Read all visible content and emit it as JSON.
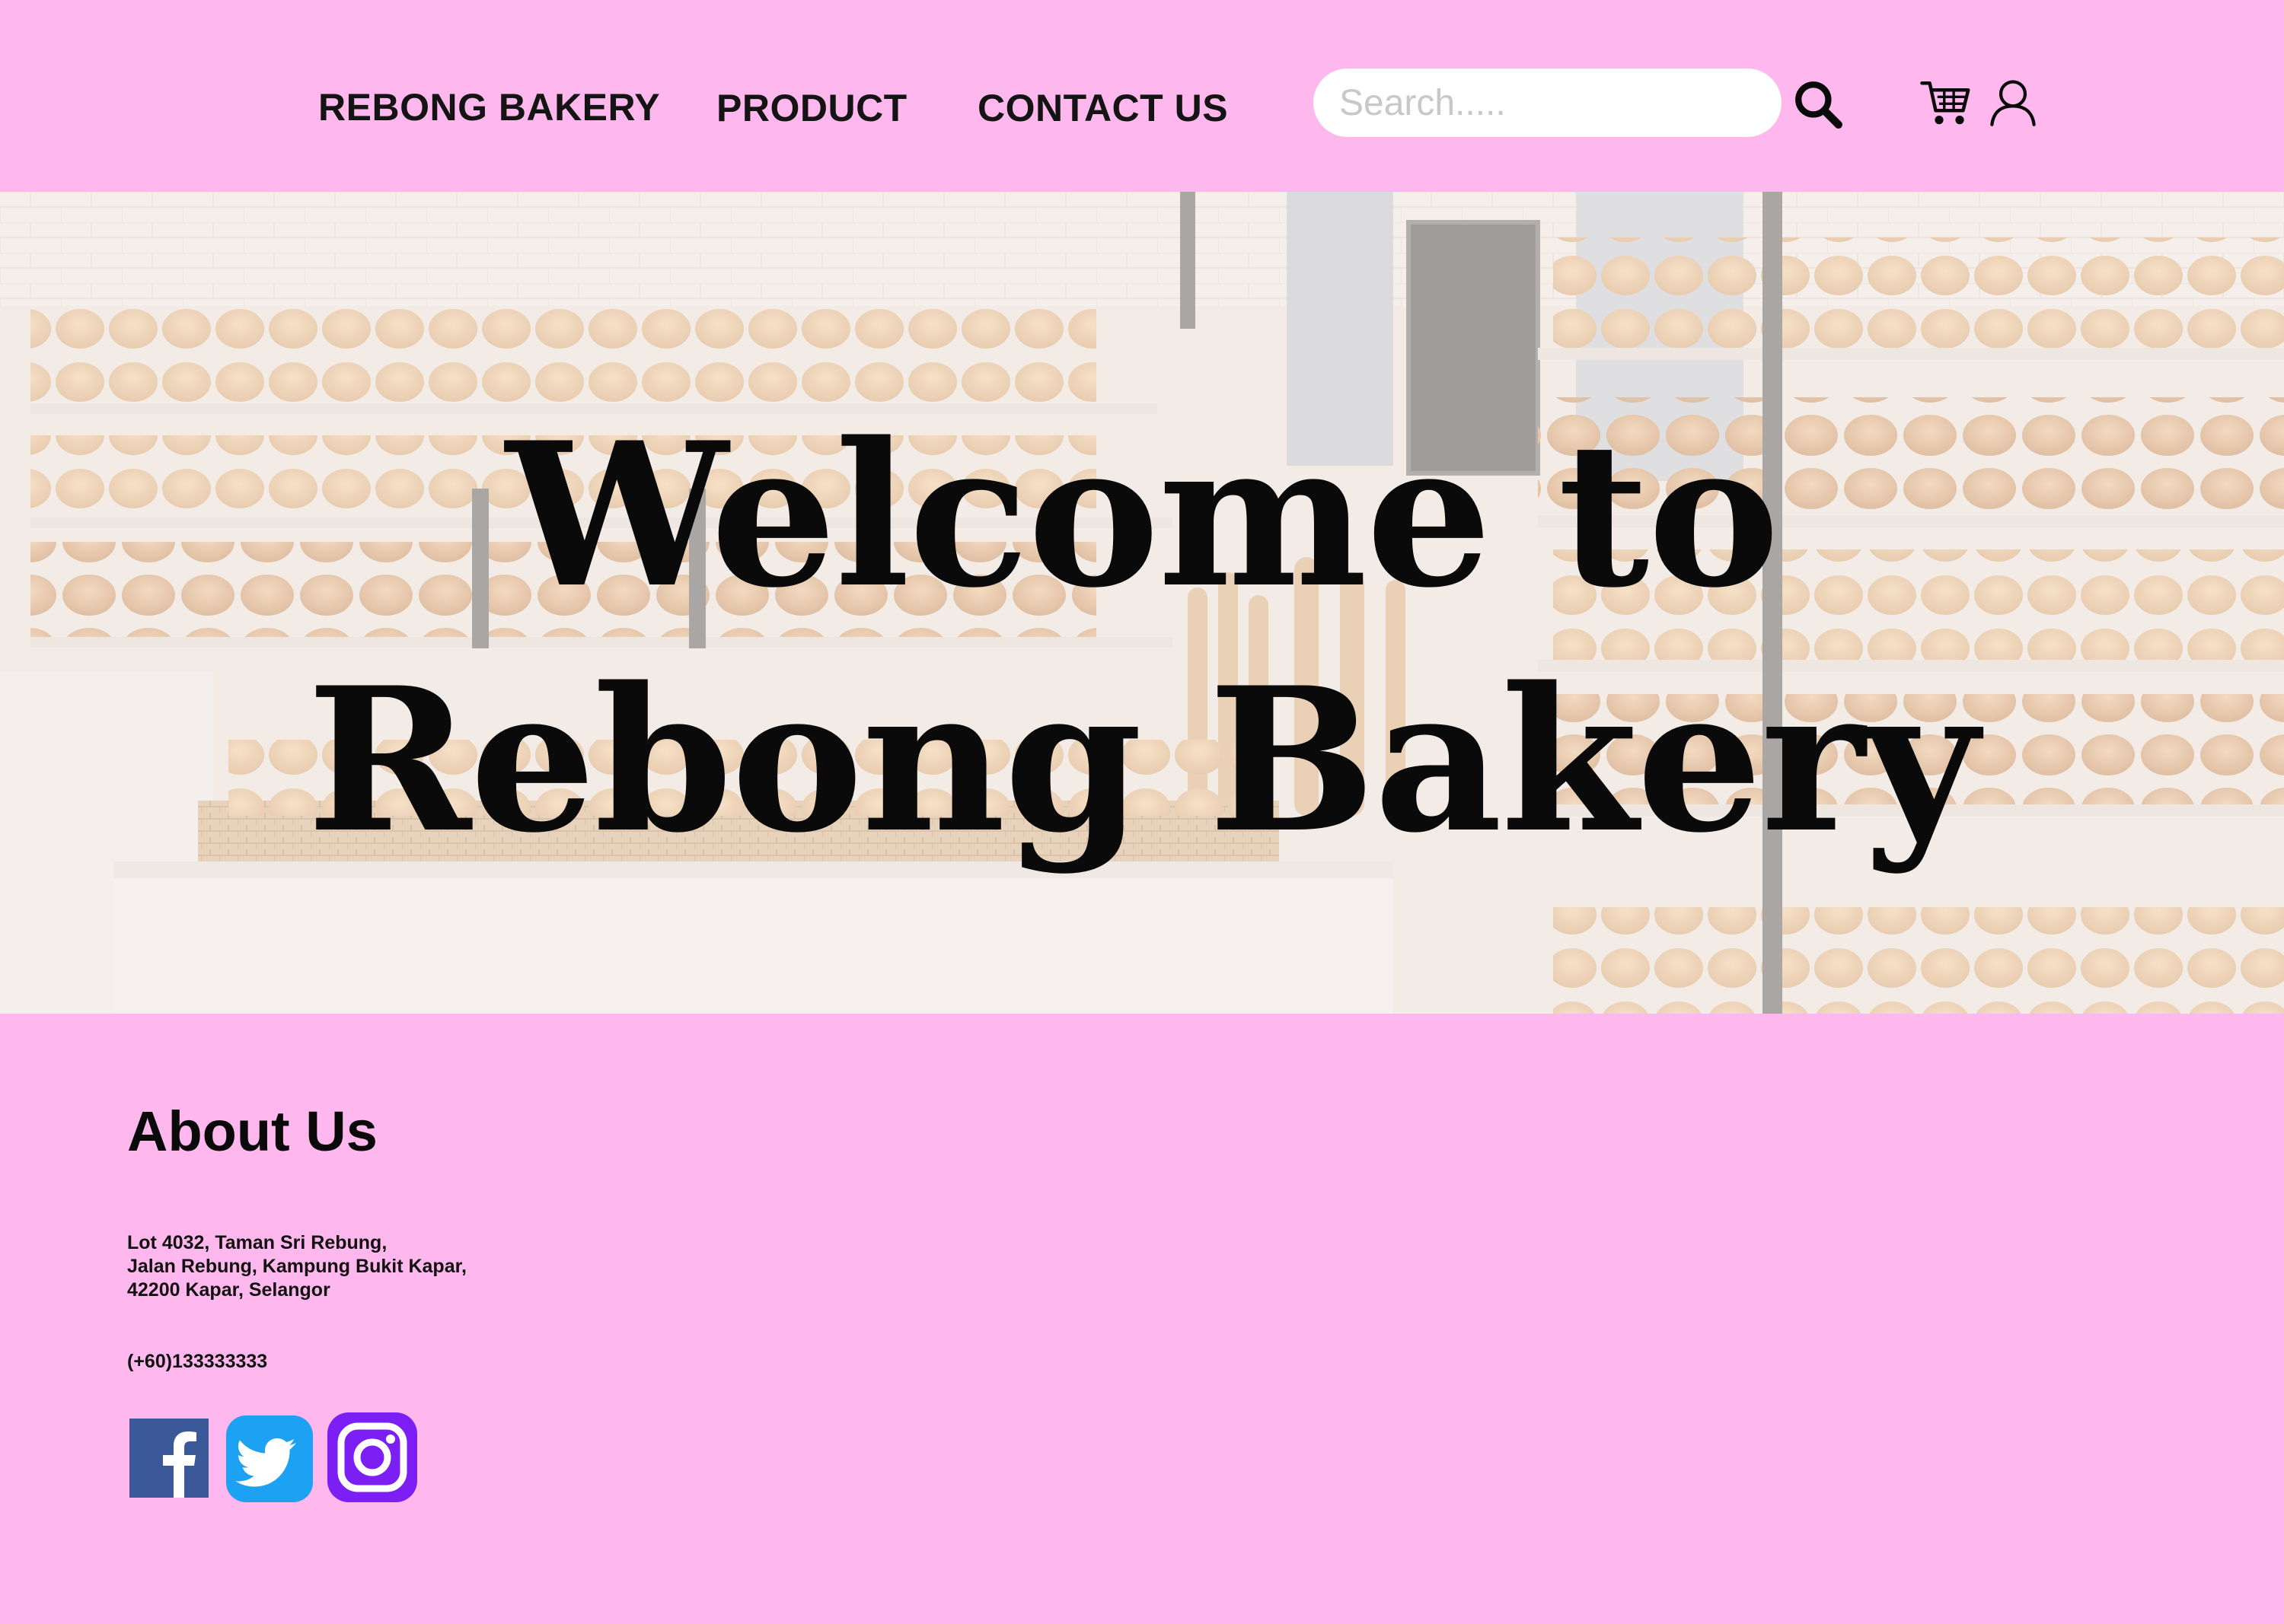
{
  "header": {
    "brand": "REBONG BAKERY",
    "nav": {
      "product": "PRODUCT",
      "contact": "CONTACT US"
    },
    "search": {
      "placeholder": "Search.....",
      "value": ""
    },
    "icons": {
      "search": "search-icon",
      "cart": "cart-icon",
      "user": "user-icon"
    }
  },
  "hero": {
    "title_line1": "Welcome to",
    "title_line2": "Rebong Bakery"
  },
  "about": {
    "heading": "About Us",
    "address": [
      "Lot 4032, Taman Sri Rebung,",
      "Jalan Rebung, Kampung Bukit Kapar,",
      "42200 Kapar, Selangor"
    ],
    "phone": "(+60)133333333",
    "social": [
      {
        "name": "facebook-icon",
        "color": "#3B5998"
      },
      {
        "name": "twitter-icon",
        "color": "#1DA1F2"
      },
      {
        "name": "instagram-icon",
        "color": "#7B1FF5"
      }
    ]
  },
  "colors": {
    "background": "#FEB8EE",
    "text": "#111111",
    "search_bg": "#FFFFFF"
  }
}
